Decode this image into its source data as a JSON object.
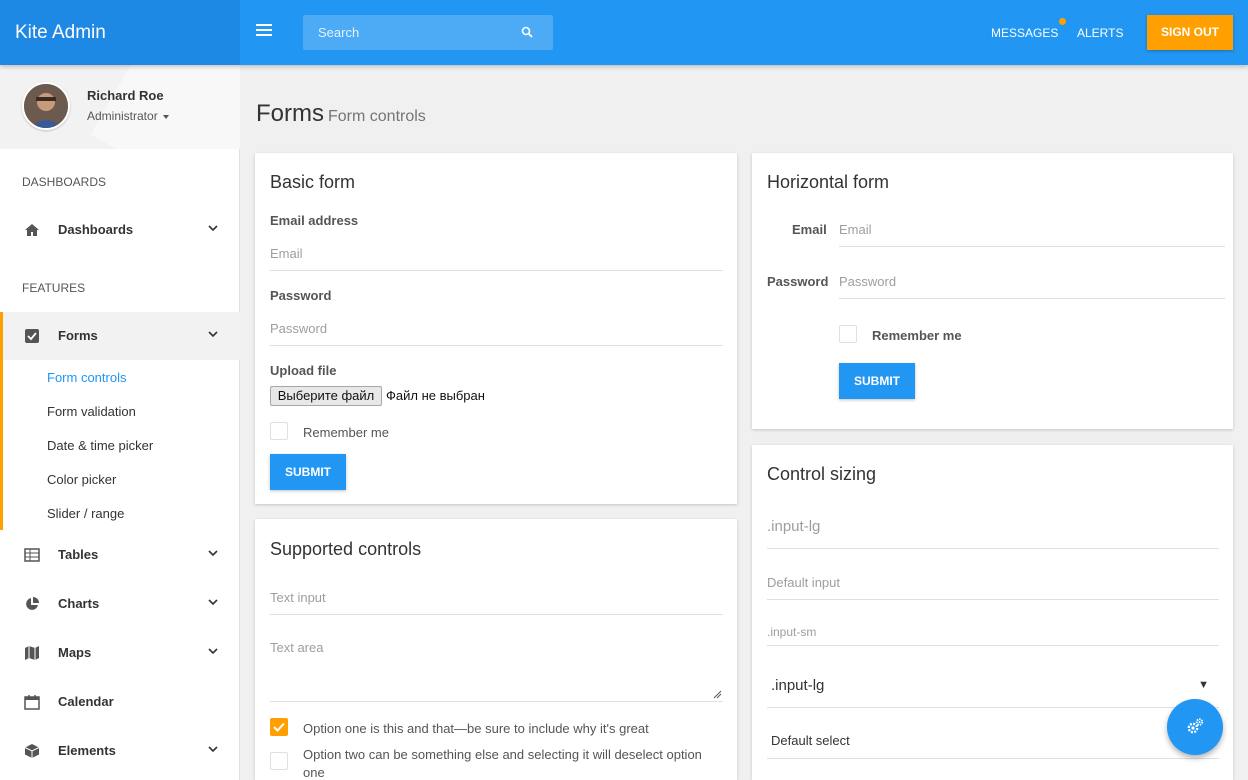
{
  "topbar": {
    "brand": "Kite Admin",
    "search_placeholder": "Search",
    "messages": "MESSAGES",
    "alerts": "ALERTS",
    "signout": "SIGN OUT"
  },
  "profile": {
    "name": "Richard Roe",
    "role": "Administrator"
  },
  "sidebar": {
    "section_dashboards": "DASHBOARDS",
    "section_features": "FEATURES",
    "items": {
      "dashboards": "Dashboards",
      "forms": "Forms",
      "tables": "Tables",
      "charts": "Charts",
      "maps": "Maps",
      "calendar": "Calendar",
      "elements": "Elements"
    },
    "forms_sub": [
      "Form controls",
      "Form validation",
      "Date & time picker",
      "Color picker",
      "Slider / range"
    ]
  },
  "page": {
    "title": "Forms",
    "subtitle": "Form controls"
  },
  "basic_form": {
    "title": "Basic form",
    "email_label": "Email address",
    "email_placeholder": "Email",
    "password_label": "Password",
    "password_placeholder": "Password",
    "upload_label": "Upload file",
    "file_button": "Выберите файл",
    "file_status": "Файл не выбран",
    "remember": "Remember me",
    "submit": "SUBMIT"
  },
  "horizontal_form": {
    "title": "Horizontal form",
    "email_label": "Email",
    "email_placeholder": "Email",
    "password_label": "Password",
    "password_placeholder": "Password",
    "remember": "Remember me",
    "submit": "SUBMIT"
  },
  "supported_controls": {
    "title": "Supported controls",
    "text_input_placeholder": "Text input",
    "text_area_placeholder": "Text area",
    "option_one": "Option one is this and that—be sure to include why it's great",
    "option_two": "Option two can be something else and selecting it will deselect option one"
  },
  "control_sizing": {
    "title": "Control sizing",
    "input_lg": ".input-lg",
    "input_default": "Default input",
    "input_sm": ".input-sm",
    "select_lg": ".input-lg",
    "select_default": "Default select"
  },
  "colors": {
    "primary": "#2196f3",
    "accent": "#ffa000"
  }
}
